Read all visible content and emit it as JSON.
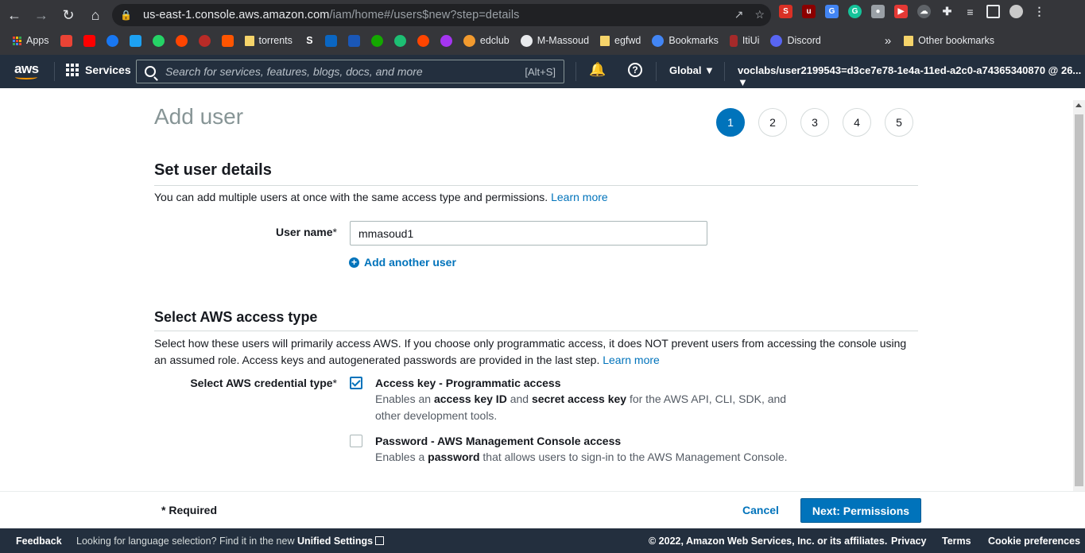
{
  "browser": {
    "url_host": "us-east-1.console.aws.amazon.com",
    "url_path": "/iam/home#/users$new?step=details",
    "bookmarks": [
      {
        "label": "Apps",
        "icon": "apps-grid-icon"
      },
      {
        "label": "torrents",
        "icon": "folder-icon"
      },
      {
        "label": "edclub",
        "icon": "edclub-icon"
      },
      {
        "label": "M-Massoud",
        "icon": "github-icon"
      },
      {
        "label": "egfwd",
        "icon": "folder-icon"
      },
      {
        "label": "Bookmarks",
        "icon": "cloud-icon"
      },
      {
        "label": "ItiUi",
        "icon": "figma-icon"
      },
      {
        "label": "Discord",
        "icon": "discord-icon"
      },
      {
        "label": "Other bookmarks",
        "icon": "folder-icon"
      }
    ],
    "overflow_label": "»"
  },
  "aws_nav": {
    "logo": "aws",
    "services_label": "Services",
    "search_placeholder": "Search for services, features, blogs, docs, and more",
    "search_shortcut": "[Alt+S]",
    "region": "Global ▼",
    "account": "voclabs/user2199543=d3ce7e78-1e4a-11ed-a2c0-a74365340870 @ 26..."
  },
  "page": {
    "title": "Add user",
    "steps": [
      "1",
      "2",
      "3",
      "4",
      "5"
    ],
    "active_step": 1
  },
  "user_details": {
    "heading": "Set user details",
    "description": "You can add multiple users at once with the same access type and permissions.",
    "learn_more": "Learn more",
    "username_label": "User name",
    "required_mark": "*",
    "username_value": "mmasoud1",
    "add_another": "Add another user"
  },
  "access_type": {
    "heading": "Select AWS access type",
    "description_line1": "Select how these users will primarily access AWS. If you choose only programmatic access, it does NOT prevent users from accessing the console using",
    "description_line2": "an assumed role. Access keys and autogenerated passwords are provided in the last step.",
    "learn_more": "Learn more",
    "credential_label": "Select AWS credential type",
    "options": [
      {
        "title": "Access key - Programmatic access",
        "checked": true,
        "desc_a": "Enables an ",
        "desc_b": "access key ID",
        "desc_c": " and ",
        "desc_d": "secret access key",
        "desc_e": " for the AWS API, CLI, SDK, and",
        "desc_f": "other development tools."
      },
      {
        "title": "Password - AWS Management Console access",
        "checked": false,
        "desc_a": "Enables a ",
        "desc_b": "password",
        "desc_c": " that allows users to sign-in to the AWS Management Console."
      }
    ]
  },
  "actions": {
    "required_note": "* Required",
    "cancel": "Cancel",
    "next": "Next: Permissions"
  },
  "footer": {
    "feedback": "Feedback",
    "language_text": "Looking for language selection? Find it in the new",
    "unified_settings": "Unified Settings",
    "copyright": "© 2022, Amazon Web Services, Inc. or its affiliates.",
    "privacy": "Privacy",
    "terms": "Terms",
    "cookie": "Cookie preferences"
  },
  "colors": {
    "aws_nav": "#232f3e",
    "accent": "#0073bb",
    "aws_orange": "#ff9900"
  }
}
